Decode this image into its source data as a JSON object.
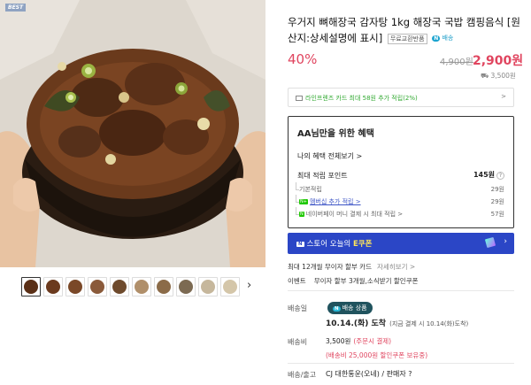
{
  "product": {
    "badge": "BEST",
    "title": "우거지 뼈해장국 감자탕 1kg 해장국 국밥 캠핑음식 [원산지:상세설명에 표시]",
    "tag_free": "무료교환반품",
    "tag_ship": "배송",
    "discount": "40%",
    "original_price": "4,900원",
    "sale_price": "2,900원",
    "shipping_fee": "3,500원"
  },
  "card_banner": {
    "text": "라인프렌즈 카드 최대 58원 추가 적립(2%)",
    "arrow": ">"
  },
  "benefits": {
    "heading": "AA님만을 위한 혜택",
    "view_all": "나의 혜택 전체보기 >",
    "max_label": "최대 적립 포인트",
    "max_value": "145원",
    "help_icon": "?",
    "rows": [
      {
        "label": "기본적립",
        "value": "29원"
      },
      {
        "label": "멤버십 추가 적립 >",
        "value": "29원",
        "badge": "N+"
      },
      {
        "label": "네이버페이 머니 결제 시 최대 적립 >",
        "value": "57원",
        "badge": "N"
      }
    ]
  },
  "coupon": {
    "badge": "N",
    "store": "스토어 오늘의 ",
    "highlight": "E쿠폰",
    "arrow": "›"
  },
  "installment": {
    "text": "최대 12개월 무이자 할부 카드",
    "link": "자세히보기 >"
  },
  "event": {
    "label": "이벤트",
    "text": "무이자 할부 3개월,소식받기 할인쿠폰"
  },
  "delivery": {
    "date_label": "배송일",
    "badge": "배송 상품",
    "badge_prefix": "N",
    "arrival": "10.14.(화) 도착",
    "arrival_note": "(지금 결제 시 10.14(화)도착)",
    "fee_label": "배송비",
    "fee_value": "3,500원",
    "fee_note": "(주문시 결제)",
    "coupon_note": "(배송비 25,000원 할인쿠폰 보유중)",
    "carrier_label": "배송/출고",
    "carrier": "CJ 대한통운(오네) / 판매자 ?"
  },
  "thumbnails": [
    "1",
    "2",
    "3",
    "4",
    "5",
    "6",
    "7",
    "8",
    "9",
    "10"
  ],
  "colors": {
    "accent": "#e0455f",
    "brand": "#2b46c6",
    "ship": "#20535e"
  }
}
